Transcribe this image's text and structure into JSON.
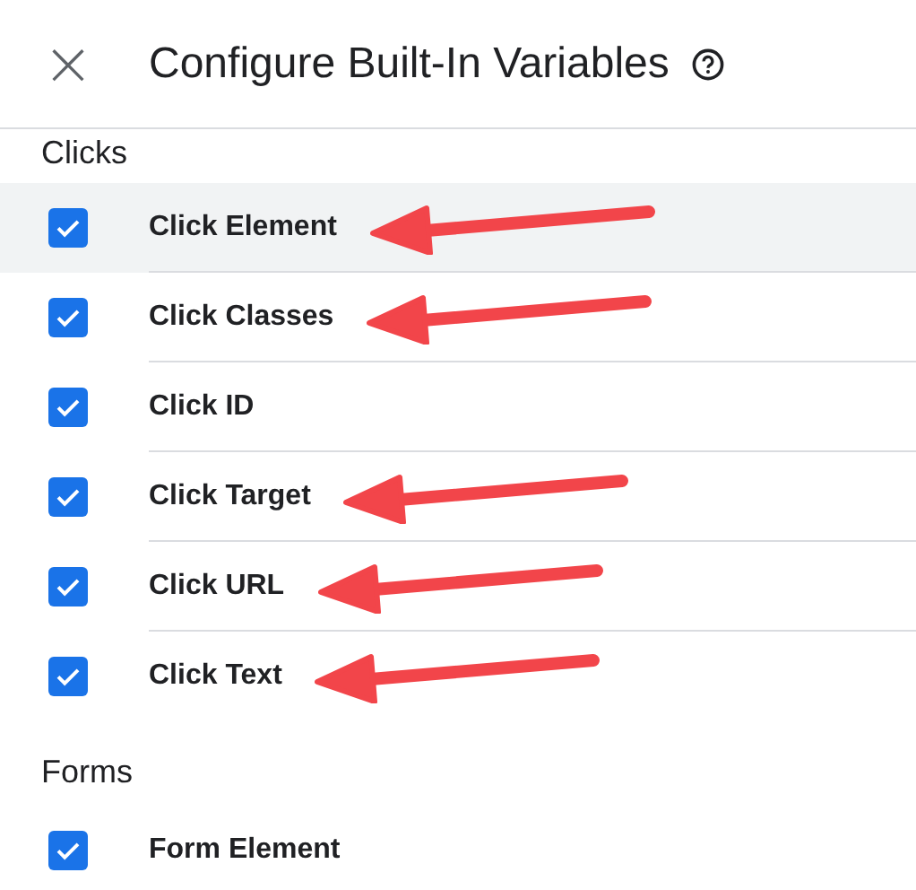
{
  "header": {
    "title": "Configure Built-In Variables",
    "close_icon": "×"
  },
  "sections": [
    {
      "heading": "Clicks",
      "items": [
        {
          "label": "Click Element",
          "checked": true,
          "highlighted": true,
          "arrow": true
        },
        {
          "label": "Click Classes",
          "checked": true,
          "highlighted": false,
          "arrow": true
        },
        {
          "label": "Click ID",
          "checked": true,
          "highlighted": false,
          "arrow": false
        },
        {
          "label": "Click Target",
          "checked": true,
          "highlighted": false,
          "arrow": true
        },
        {
          "label": "Click URL",
          "checked": true,
          "highlighted": false,
          "arrow": true
        },
        {
          "label": "Click Text",
          "checked": true,
          "highlighted": false,
          "arrow": true
        }
      ]
    },
    {
      "heading": "Forms",
      "items": [
        {
          "label": "Form Element",
          "checked": true,
          "highlighted": false,
          "arrow": false
        }
      ]
    }
  ]
}
